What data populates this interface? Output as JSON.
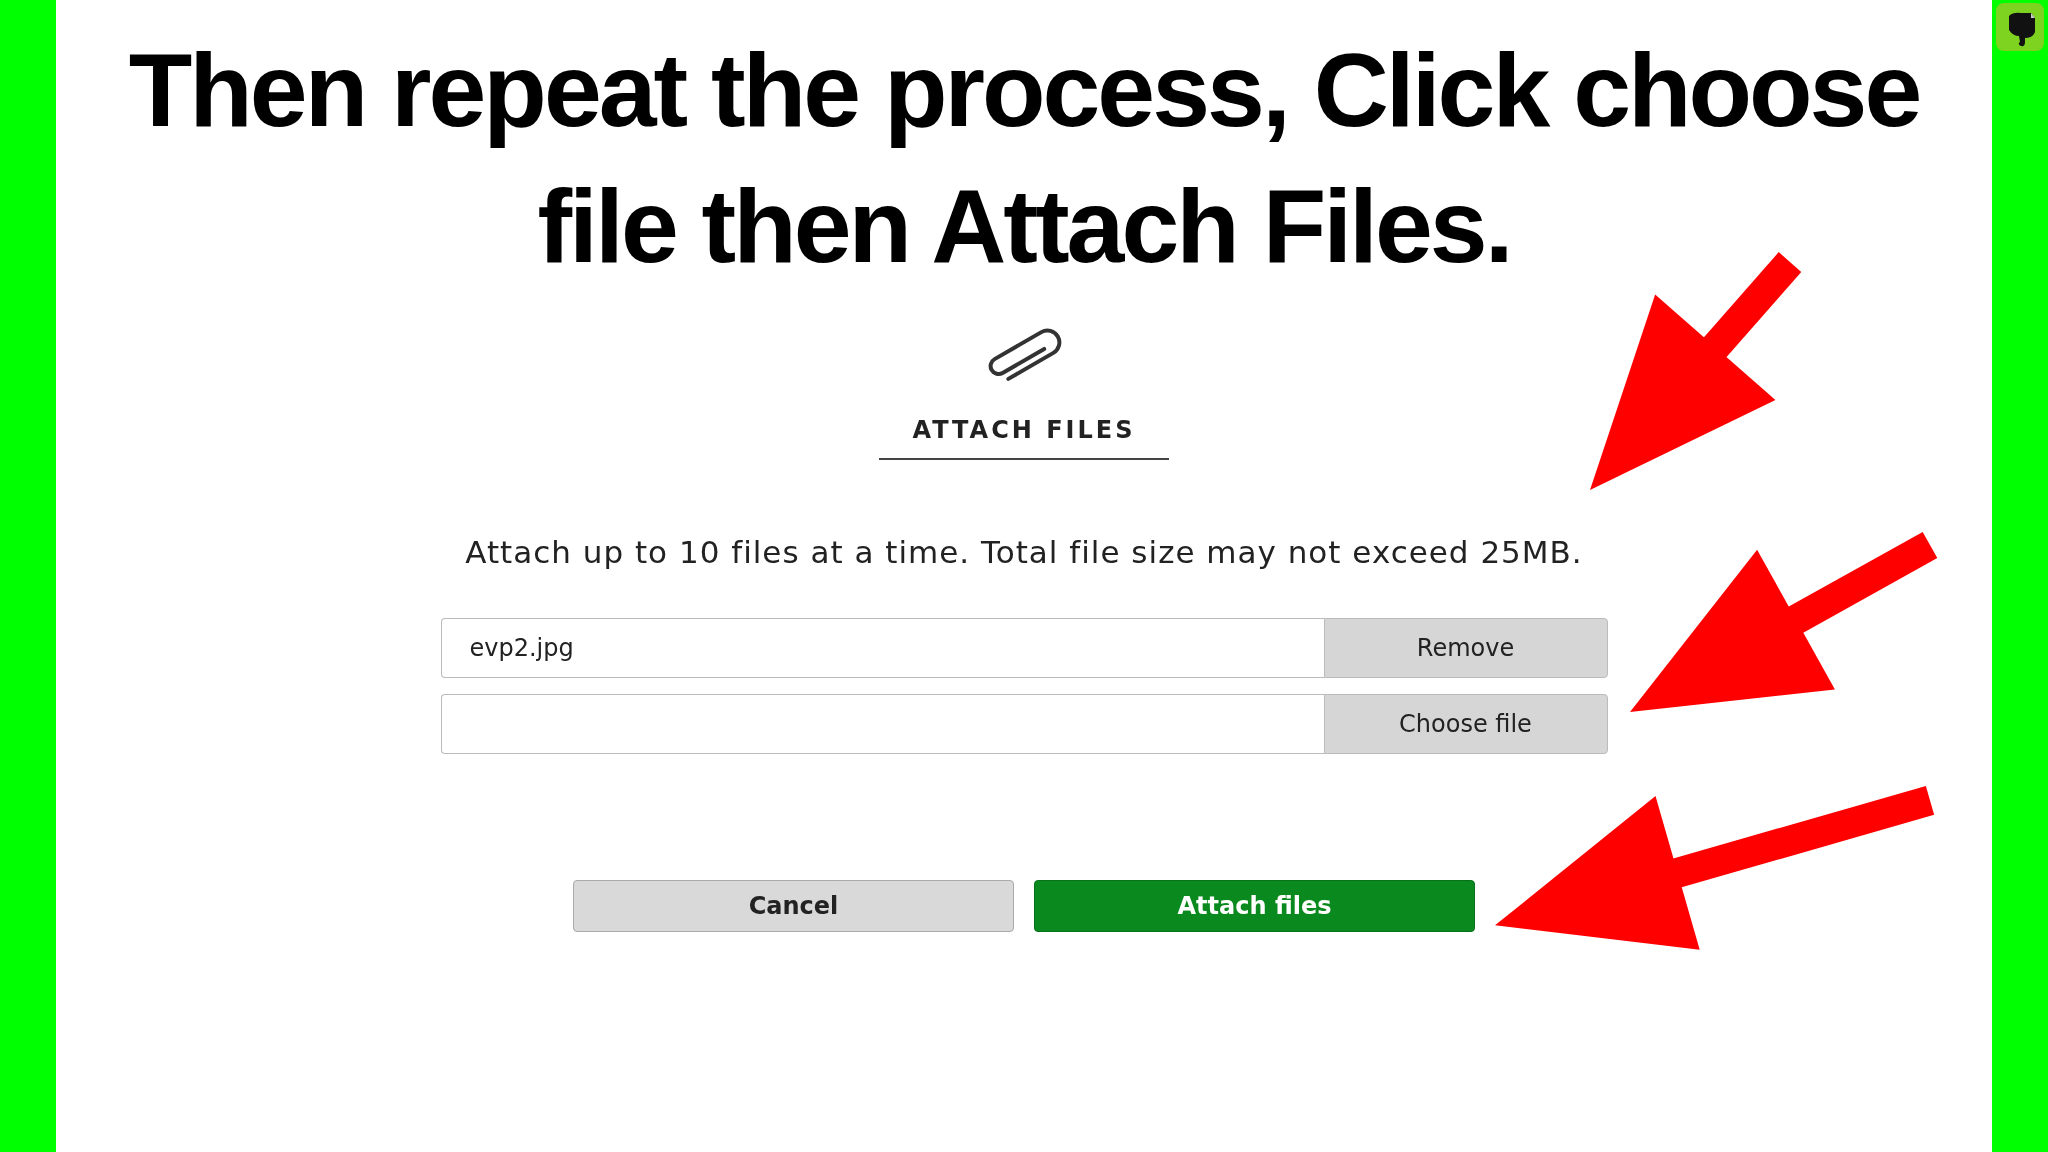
{
  "caption": [
    "Then repeat the process, Click choose",
    "file then Attach Files."
  ],
  "dialog": {
    "title": "ATTACH FILES",
    "description": "Attach up to 10 files at a time. Total file size may not exceed 25MB.",
    "files": [
      {
        "value": "evp2.jpg",
        "action": "Remove"
      },
      {
        "action": "Choose file"
      }
    ],
    "buttons": [
      {
        "label": "Cancel",
        "kind": "secondary"
      },
      {
        "label": "Attach files",
        "kind": "primary"
      }
    ]
  }
}
